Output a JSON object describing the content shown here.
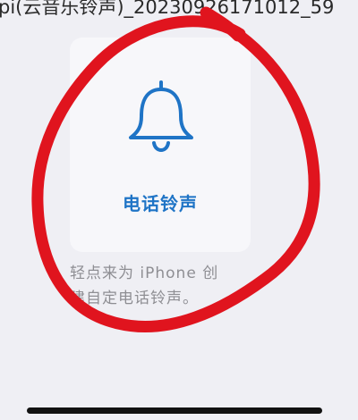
{
  "header": {
    "filename_text": "pi(云音乐铃声)_20230926171012_59"
  },
  "ringtone_tile": {
    "icon": "bell-icon",
    "label": "电话铃声",
    "accent_color": "#1f74c6"
  },
  "description": {
    "line1": "轻点来为 iPhone 创",
    "line2": "建自定电话铃声。"
  },
  "annotation": {
    "color": "#e0141e",
    "shape": "hand-drawn circle"
  }
}
